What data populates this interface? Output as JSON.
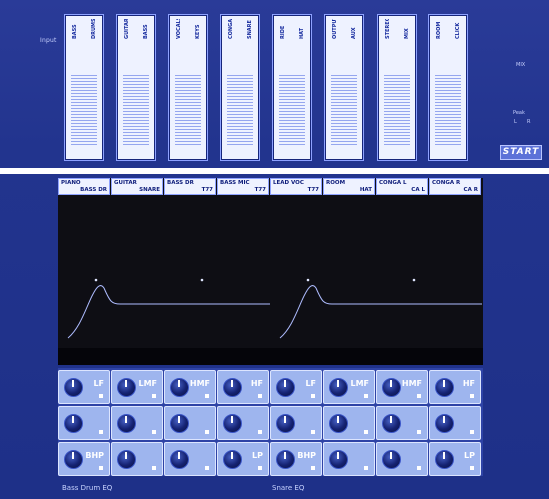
{
  "header": {
    "input_label": "Input"
  },
  "meters": [
    {
      "tops": [
        "BASS DR",
        "DRUMS"
      ]
    },
    {
      "tops": [
        "GUITAR",
        "BASS"
      ]
    },
    {
      "tops": [
        "VOCALS",
        "KEYS"
      ]
    },
    {
      "tops": [
        "CONGA",
        "SNARE"
      ]
    },
    {
      "tops": [
        "RIDE",
        "HAT"
      ]
    },
    {
      "tops": [
        "OUTPUT",
        "AUX"
      ]
    },
    {
      "tops": [
        "STEREO",
        "MIX"
      ]
    },
    {
      "tops": [
        "ROOM",
        "CLICK"
      ]
    }
  ],
  "side": {
    "label_top": "MIX",
    "peak_label": "Peak",
    "peak_l": "L",
    "peak_r": "R",
    "start_label": "START"
  },
  "channels": [
    {
      "l1": "PIANO",
      "l2": "BASS DR"
    },
    {
      "l1": "GUITAR",
      "l2": "SNARE"
    },
    {
      "l1": "BASS DR",
      "l2": "T77"
    },
    {
      "l1": "BASS MIC",
      "l2": "T77"
    },
    {
      "l1": "LEAD VOC",
      "l2": "T77"
    },
    {
      "l1": "ROOM",
      "l2": "HAT"
    },
    {
      "l1": "CONGA L",
      "l2": "CA L"
    },
    {
      "l1": "CONGA R",
      "l2": "CA R"
    }
  ],
  "eq_rows": [
    [
      "LF",
      "LMF",
      "HMF",
      "HF",
      "LF",
      "LMF",
      "HMF",
      "HF"
    ],
    [
      "",
      "",
      "",
      "",
      "",
      "",
      "",
      ""
    ],
    [
      "BHP",
      "",
      "",
      "LP",
      "BHP",
      "",
      "",
      "LP"
    ]
  ],
  "footer": {
    "left": "Bass Drum EQ",
    "right": "Snare EQ"
  },
  "colors": {
    "background": "#22348e",
    "panel": "#eef2ff",
    "graph_bg": "#0e0e14",
    "knob_cell": "#9eb5ee"
  }
}
